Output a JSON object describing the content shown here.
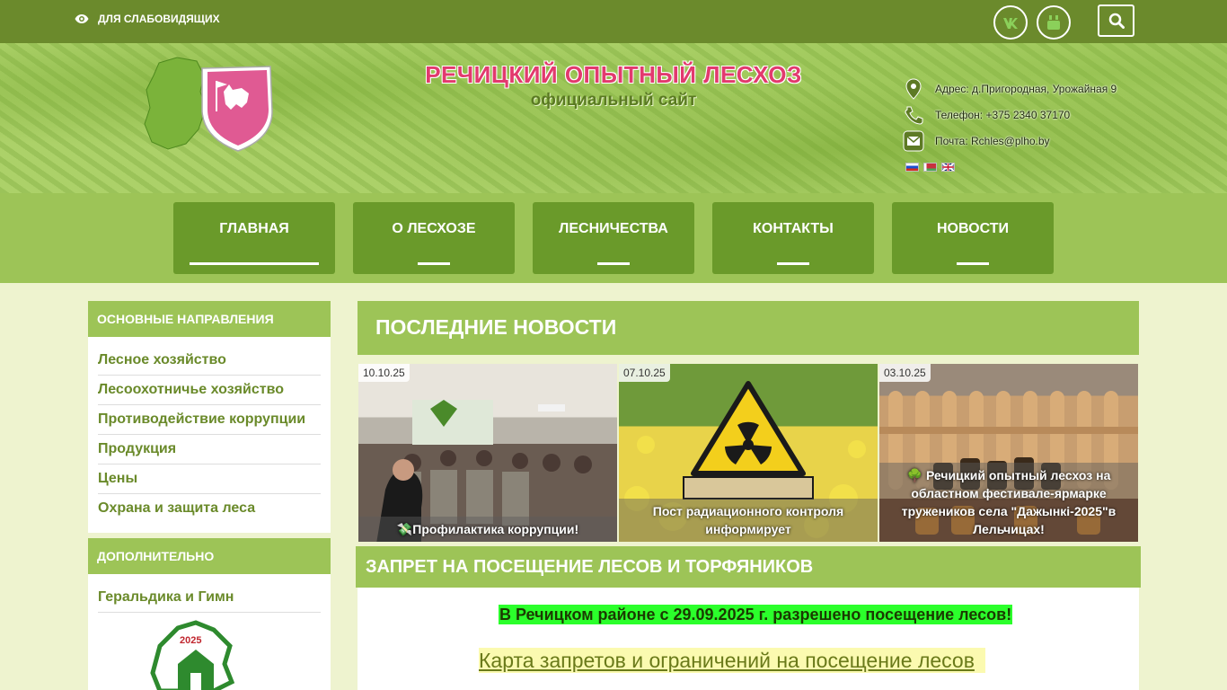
{
  "topbar": {
    "visually_impaired_label": "ДЛЯ СЛАБОВИДЯЩИХ",
    "social_icons": [
      "vk-icon",
      "youtube-icon"
    ],
    "search_icon": "search-icon"
  },
  "header": {
    "title": "РЕЧИЦКИЙ ОПЫТНЫЙ ЛЕСХОЗ",
    "subtitle": "официальный сайт",
    "address": "Адрес: д.Пригородная, Урожайная 9",
    "phone": "Телефон: +375 2340 37170",
    "email": "Почта: Rchles@plho.by",
    "languages": [
      "ru",
      "by",
      "en"
    ]
  },
  "nav": {
    "items": [
      {
        "label": "ГЛАВНАЯ",
        "active": true
      },
      {
        "label": "О ЛЕСХОЗЕ"
      },
      {
        "label": "ЛЕСНИЧЕСТВА"
      },
      {
        "label": "КОНТАКТЫ"
      },
      {
        "label": "НОВОСТИ"
      }
    ]
  },
  "sidebar": {
    "main_heading": "ОСНОВНЫЕ НАПРАВЛЕНИЯ",
    "main_items": [
      "Лесное хозяйство",
      "Лесоохотничье хозяйство",
      "Противодействие коррупции",
      "Продукция",
      "Цены",
      "Охрана и защита леса"
    ],
    "extra_heading": "ДОПОЛНИТЕЛЬНО",
    "extra_items": [
      "Геральдика и Гимн"
    ],
    "badge_year": "2025"
  },
  "news": {
    "heading": "ПОСЛЕДНИЕ НОВОСТИ",
    "cards": [
      {
        "date": "10.10.25",
        "caption": "💸Профилактика коррупции!"
      },
      {
        "date": "07.10.25",
        "caption": "Пост радиационного контроля информирует"
      },
      {
        "date": "03.10.25",
        "caption": "🌳 Речицкий опытный лесхоз на областном фестивале-ярмарке тружеников села \"Дажынкі-2025\"в Лельчицах!"
      }
    ]
  },
  "ban": {
    "heading": "ЗАПРЕТ НА ПОСЕЩЕНИЕ ЛЕСОВ И ТОРФЯНИКОВ",
    "notice": "В Речицком районе с 29.09.2025 г. разрешено посещение лесов!",
    "map_link": "Карта запретов и ограничений на посещение лесов"
  },
  "colors": {
    "topbar": "#6b8a2c",
    "nav_band": "#9dc457",
    "nav_button": "#6a9a2a",
    "accent_pink": "#e23a6e",
    "page_bg": "#eef3cf"
  }
}
